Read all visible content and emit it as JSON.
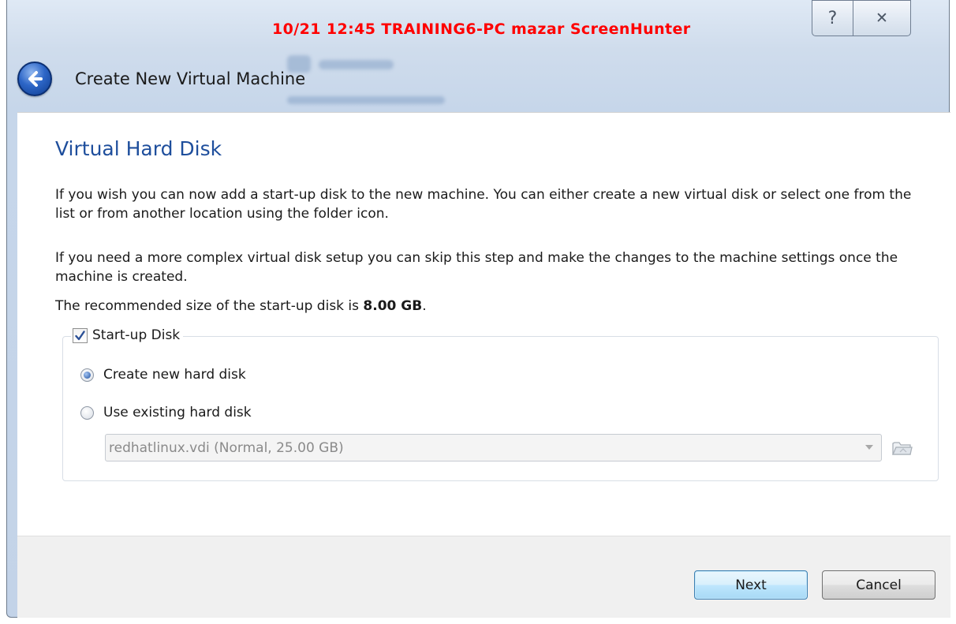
{
  "window": {
    "watermark": "10/21 12:45 TRAINING6-PC mazar ScreenHunter",
    "help_glyph": "?",
    "close_glyph": "✕",
    "wizard_title": "Create New Virtual Machine"
  },
  "page": {
    "heading": "Virtual Hard Disk",
    "paragraph1": "If you wish you can now add a start-up disk to the new machine. You can either create a new virtual disk or select one from the list or from another location using the folder icon.",
    "paragraph2": "If you need a more complex virtual disk setup you can skip this step and make the changes to the machine settings once the machine is created.",
    "recommended_prefix": "The recommended size of the start-up disk is ",
    "recommended_size": "8.00 GB",
    "recommended_suffix": "."
  },
  "startup_disk": {
    "label": "Start-up Disk",
    "checked": true,
    "options": [
      {
        "label": "Create new hard disk",
        "selected": true
      },
      {
        "label": "Use existing hard disk",
        "selected": false
      }
    ],
    "existing_disk_value": "redhatlinux.vdi (Normal, 25.00 GB)",
    "existing_disk_enabled": false
  },
  "buttons": {
    "next": "Next",
    "cancel": "Cancel"
  },
  "icons": {
    "back": "back-arrow-icon",
    "help": "help-icon",
    "close": "close-icon",
    "folder": "folder-icon",
    "dropdown": "chevron-down-icon",
    "checkbox": "checkmark-icon"
  },
  "colors": {
    "heading": "#1e4e9c",
    "watermark": "#ff0000",
    "next_border": "#3c7fb1"
  }
}
